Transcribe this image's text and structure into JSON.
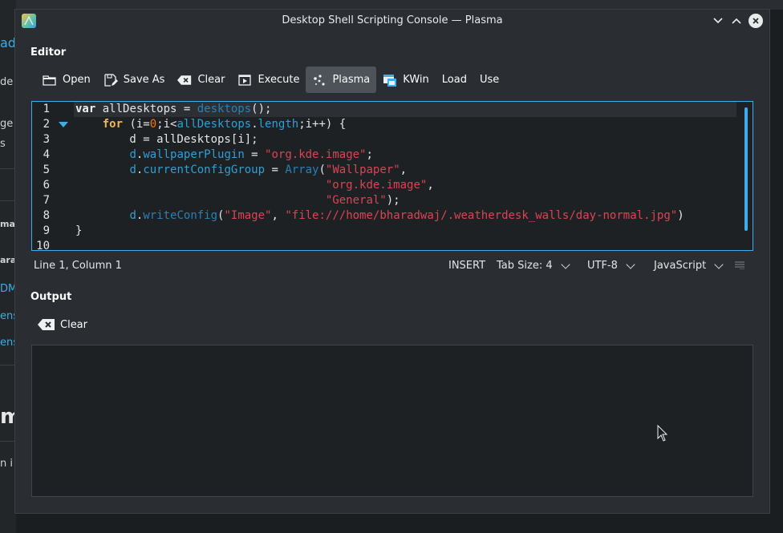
{
  "window": {
    "title": "Desktop Shell Scripting Console — Plasma"
  },
  "background_fragments": [
    "ad",
    "de",
    "ge h",
    "s",
    "mas",
    "arac",
    "DM",
    "ens",
    "ens",
    "m",
    "n i"
  ],
  "editor": {
    "section_title": "Editor",
    "toolbar": [
      {
        "label": "Open",
        "icon": "folder-open-icon"
      },
      {
        "label": "Save As",
        "icon": "save-as-icon"
      },
      {
        "label": "Clear",
        "icon": "clear-icon"
      },
      {
        "label": "Execute",
        "icon": "execute-icon"
      },
      {
        "label": "Plasma",
        "icon": "plasma-icon",
        "active": true
      },
      {
        "label": "KWin",
        "icon": "kwin-icon"
      },
      {
        "label": "Load"
      },
      {
        "label": "Use"
      }
    ],
    "line_numbers": [
      "1",
      "2",
      "3",
      "4",
      "5",
      "6",
      "7",
      "8",
      "9",
      "10"
    ],
    "code_lines": [
      "var allDesktops = desktops();",
      "    for (i=0;i<allDesktops.length;i++) {",
      "        d = allDesktops[i];",
      "        d.wallpaperPlugin = \"org.kde.image\";",
      "        d.currentConfigGroup = Array(\"Wallpaper\",",
      "                                     \"org.kde.image\",",
      "                                     \"General\");",
      "        d.writeConfig(\"Image\", \"file:///home/bharadwaj/.weatherdesk_walls/day-normal.jpg\")",
      "}",
      ""
    ]
  },
  "statusbar": {
    "position": "Line 1, Column 1",
    "mode": "INSERT",
    "tab_size": "Tab Size: 4",
    "encoding": "UTF-8",
    "language": "JavaScript"
  },
  "output": {
    "section_title": "Output",
    "clear_label": "Clear",
    "content": ""
  },
  "colors": {
    "accent": "#3daee9",
    "keyword": "#f1b65c",
    "string": "#da4453",
    "number": "#f67400"
  }
}
